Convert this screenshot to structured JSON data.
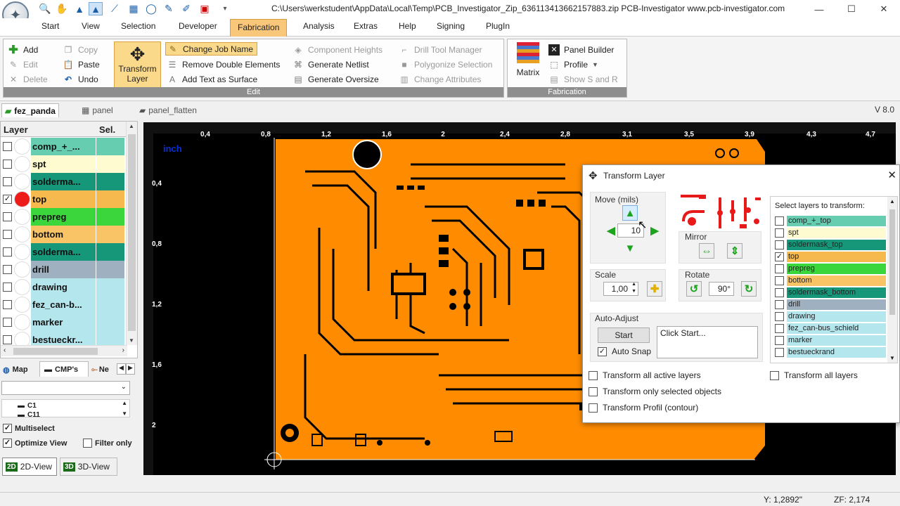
{
  "window": {
    "title": "C:\\Users\\werkstudent\\AppData\\Local\\Temp\\PCB_Investigator_Zip_636113413662157883.zip   PCB-Investigator   www.pcb-investigator.com",
    "minimize": "—",
    "maximize": "☐",
    "close": "✕"
  },
  "menu": [
    "Start",
    "View",
    "Selection",
    "Developer",
    "Fabrication",
    "Analysis",
    "Extras",
    "Help",
    "Signing",
    "PlugIn"
  ],
  "ribbon": {
    "add": "Add",
    "edit": "Edit",
    "delete": "Delete",
    "copy": "Copy",
    "paste": "Paste",
    "undo": "Undo",
    "transform_layer_1": "Transform",
    "transform_layer_2": "Layer",
    "change_job_name": "Change Job Name",
    "remove_double": "Remove Double Elements",
    "add_text_surface": "Add Text as Surface",
    "component_heights": "Component Heights",
    "generate_netlist": "Generate Netlist",
    "generate_oversize": "Generate Oversize",
    "drill_tool_manager": "Drill Tool Manager",
    "polygonize_selection": "Polygonize Selection",
    "change_attributes": "Change Attributes",
    "edit_group_label": "Edit",
    "matrix": "Matrix",
    "panel_builder": "Panel Builder",
    "profile": "Profile",
    "show_s_and_r": "Show S and R",
    "fabrication_group_label": "Fabrication"
  },
  "doc_tabs": [
    "fez_panda",
    "panel",
    "panel_flatten"
  ],
  "version": "V 8.0",
  "layer_panel": {
    "col_layer": "Layer",
    "col_sel": "Sel.",
    "layers": [
      {
        "name": "comp_+_...",
        "color": "#66cdb0",
        "checked": false,
        "dot": "#ffffff"
      },
      {
        "name": "spt",
        "color": "#fffbd0",
        "checked": false,
        "dot": "#ffffff"
      },
      {
        "name": "solderma...",
        "color": "#16977a",
        "checked": false,
        "dot": "#ffffff"
      },
      {
        "name": "top",
        "color": "#f6b94e",
        "checked": true,
        "dot": "#ee1b1b"
      },
      {
        "name": "prepreg",
        "color": "#3bd63b",
        "checked": false,
        "dot": "#ffffff"
      },
      {
        "name": "bottom",
        "color": "#f9c466",
        "checked": false,
        "dot": "#ffffff"
      },
      {
        "name": "solderma...",
        "color": "#16977a",
        "checked": false,
        "dot": "#ffffff"
      },
      {
        "name": "drill",
        "color": "#9fb1c0",
        "checked": false,
        "dot": "#ffffff"
      },
      {
        "name": "drawing",
        "color": "#b4e6ee",
        "checked": false,
        "dot": "#ffffff"
      },
      {
        "name": "fez_can-b...",
        "color": "#b4e6ee",
        "checked": false,
        "dot": "#ffffff"
      },
      {
        "name": "marker",
        "color": "#b4e6ee",
        "checked": false,
        "dot": "#ffffff"
      },
      {
        "name": "bestueckr...",
        "color": "#b4e6ee",
        "checked": false,
        "dot": "#ffffff"
      }
    ]
  },
  "bottom_panel": {
    "tabs": [
      "Map",
      "CMP's",
      "Ne"
    ],
    "components": [
      "C1",
      "C11"
    ],
    "multiselect": "Multiselect",
    "optimize_view": "Optimize View",
    "filter_only": "Filter only",
    "view_2d": "2D-View",
    "view_3d": "3D-View",
    "badge_2d": "2D",
    "badge_3d": "3D"
  },
  "canvas": {
    "unit": "inch",
    "x_ticks": [
      "0,4",
      "0,8",
      "1,2",
      "1,6",
      "2",
      "2,4",
      "2,8",
      "3,1",
      "3,5",
      "3,9",
      "4,3",
      "4,7"
    ],
    "y_ticks": [
      "0,4",
      "0,8",
      "1,2",
      "1,6",
      "2"
    ],
    "board_color": "#ff8c00"
  },
  "dialog": {
    "title": "Transform Layer",
    "move_label": "Move (mils)",
    "move_value": "10",
    "mirror_label": "Mirror",
    "scale_label": "Scale",
    "scale_value": "1,00",
    "rotate_label": "Rotate",
    "rotate_value": "90°",
    "auto_adjust_label": "Auto-Adjust",
    "start_button": "Start",
    "auto_snap": "Auto Snap",
    "log_text": "Click Start...",
    "select_layers_label": "Select layers to transform:",
    "transform_all_active": "Transform all active layers",
    "transform_only_selected": "Transform only selected objects",
    "transform_profil": "Transform Profil (contour)",
    "transform_all_layers": "Transform all layers",
    "layers": [
      {
        "name": "comp_+_top",
        "color": "#66cdb0",
        "checked": false
      },
      {
        "name": "spt",
        "color": "#fffbd0",
        "checked": false
      },
      {
        "name": "soldermask_top",
        "color": "#16977a",
        "checked": false
      },
      {
        "name": "top",
        "color": "#f6b94e",
        "checked": true
      },
      {
        "name": "prepreg",
        "color": "#3bd63b",
        "checked": false
      },
      {
        "name": "bottom",
        "color": "#f9c466",
        "checked": false
      },
      {
        "name": "soldermask_bottom",
        "color": "#16977a",
        "checked": false
      },
      {
        "name": "drill",
        "color": "#9fb1c0",
        "checked": false
      },
      {
        "name": "drawing",
        "color": "#b4e6ee",
        "checked": false
      },
      {
        "name": "fez_can-bus_schield",
        "color": "#b4e6ee",
        "checked": false
      },
      {
        "name": "marker",
        "color": "#b4e6ee",
        "checked": false
      },
      {
        "name": "bestueckrand",
        "color": "#b4e6ee",
        "checked": false
      }
    ]
  },
  "status": {
    "y": "Y: 1,2892\"",
    "zf": "ZF: 2,174"
  }
}
